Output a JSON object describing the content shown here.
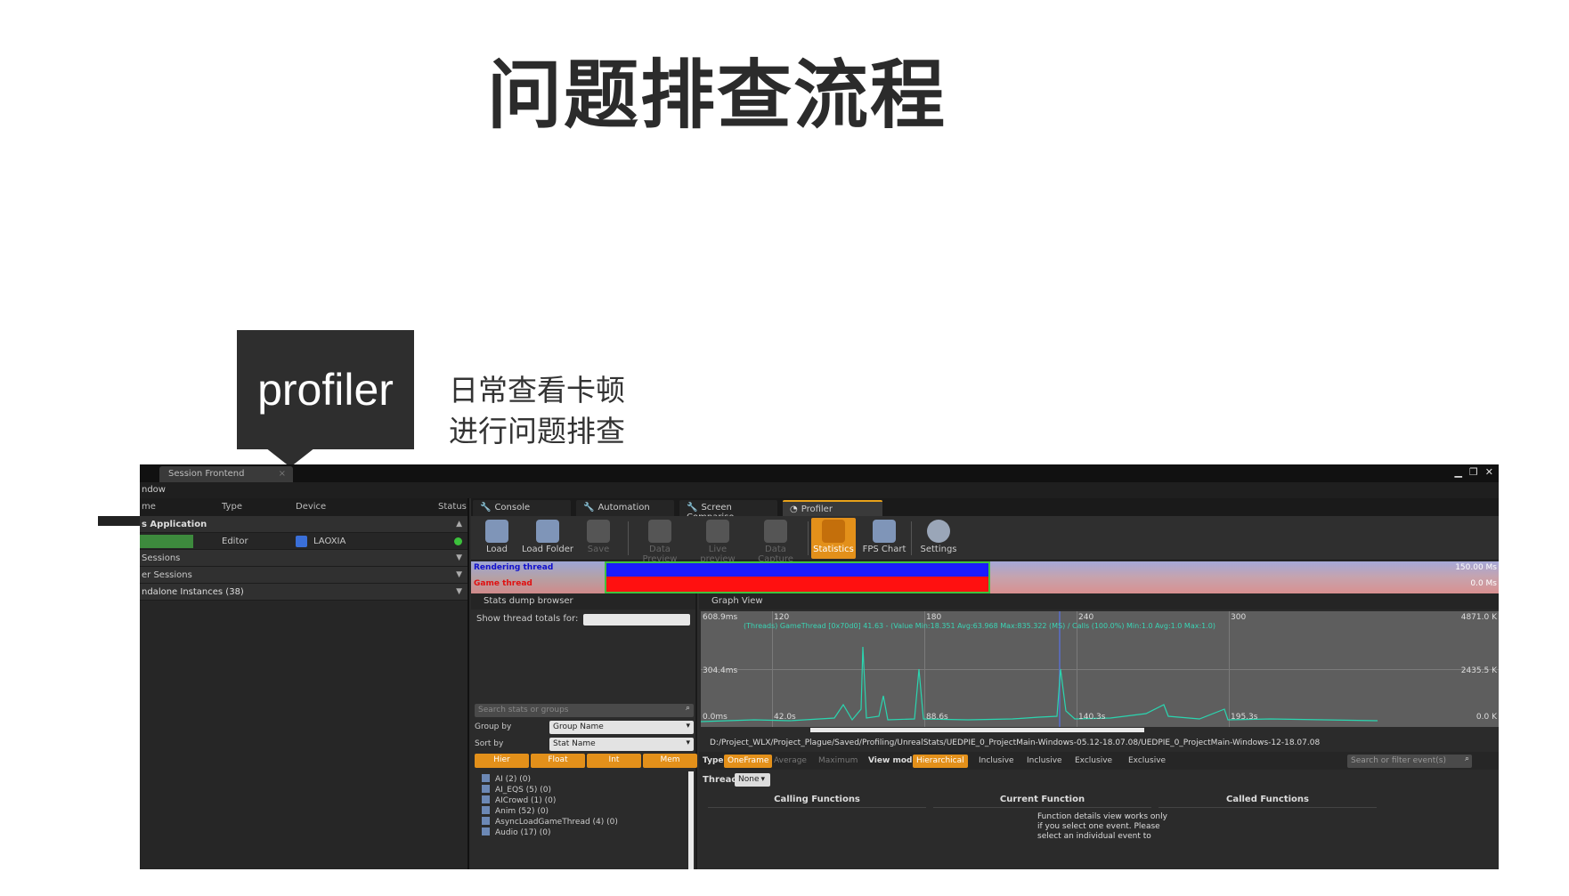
{
  "slide": {
    "title": "问题排查流程",
    "callout_label": "profiler",
    "callout_desc_line1": "日常查看卡顿",
    "callout_desc_line2": "进行问题排查"
  },
  "window": {
    "tab_label": "Session Frontend",
    "menu_label": "ndow",
    "left_panel": {
      "columns": [
        "me",
        "Type",
        "Device",
        "Status"
      ],
      "rows": [
        {
          "label": "s Application"
        },
        {
          "type": "Editor",
          "device": "LAOXIA"
        },
        {
          "label": "Sessions"
        },
        {
          "label": "er Sessions"
        },
        {
          "label": "ndalone Instances (38)"
        }
      ]
    },
    "tabs": [
      "Console",
      "Automation",
      "Screen Compariso",
      "Profiler"
    ],
    "toolbar": [
      "Load",
      "Load Folder",
      "Save",
      "Data Preview",
      "Live preview",
      "Data Capture",
      "Statistics",
      "FPS Chart",
      "Settings"
    ],
    "thread_strip": {
      "rendering_label": "Rendering thread",
      "game_label": "Game thread",
      "top_value": "150.00 Ms",
      "bottom_value": "0.0 Ms"
    },
    "stats_browser": {
      "title": "Stats dump browser",
      "show_totals_label": "Show thread totals for:",
      "search_placeholder": "Search stats or groups",
      "group_by_label": "Group by",
      "group_by_value": "Group Name",
      "sort_by_label": "Sort by",
      "sort_by_value": "Stat Name",
      "buttons": [
        "Hier",
        "Float",
        "Int",
        "Mem"
      ],
      "tree_items": [
        "AI (2) (0)",
        "AI_EQS (5) (0)",
        "AICrowd (1) (0)",
        "Anim (52) (0)",
        "AsyncLoadGameThread (4) (0)",
        "Audio (17) (0)"
      ]
    },
    "graph_view": {
      "title": "Graph View",
      "y_labels": [
        "608.9ms",
        "304.4ms",
        "0.0ms"
      ],
      "x_top_labels": [
        "120",
        "180",
        "240",
        "300"
      ],
      "x_bottom_labels": [
        "42.0s",
        "88.6s",
        "140.3s",
        "195.3s"
      ],
      "right_labels": [
        "4871.0 K",
        "2435.5 K",
        "0.0 K"
      ],
      "caption": "(Threads) GameThread [0x70d0] 41.63 - (Value Min:18.351 Avg:63.968 Max:835.322 (MS) / Calls (100.0%) Min:1.0 Avg:1.0 Max:1.0)",
      "path": "D:/Project_WLX/Project_Plague/Saved/Profiling/UnrealStats/UEDPIE_0_ProjectMain-Windows-05.12-18.07.08/UEDPIE_0_ProjectMain-Windows-12-18.07.08",
      "type_label": "Type",
      "type_options": [
        "OneFrame",
        "Average",
        "Maximum"
      ],
      "view_mode_label": "View mode",
      "view_mode_options": [
        "Hierarchical",
        "Inclusive",
        "Inclusive",
        "Exclusive",
        "Exclusive"
      ],
      "filter_placeholder": "Search or filter event(s)",
      "thread_label": "Thread",
      "thread_value": "None",
      "func_headers": [
        "Calling Functions",
        "Current Function",
        "Called Functions"
      ],
      "func_desc": "Function details view works only if you select one event. Please select an individual event to"
    }
  }
}
